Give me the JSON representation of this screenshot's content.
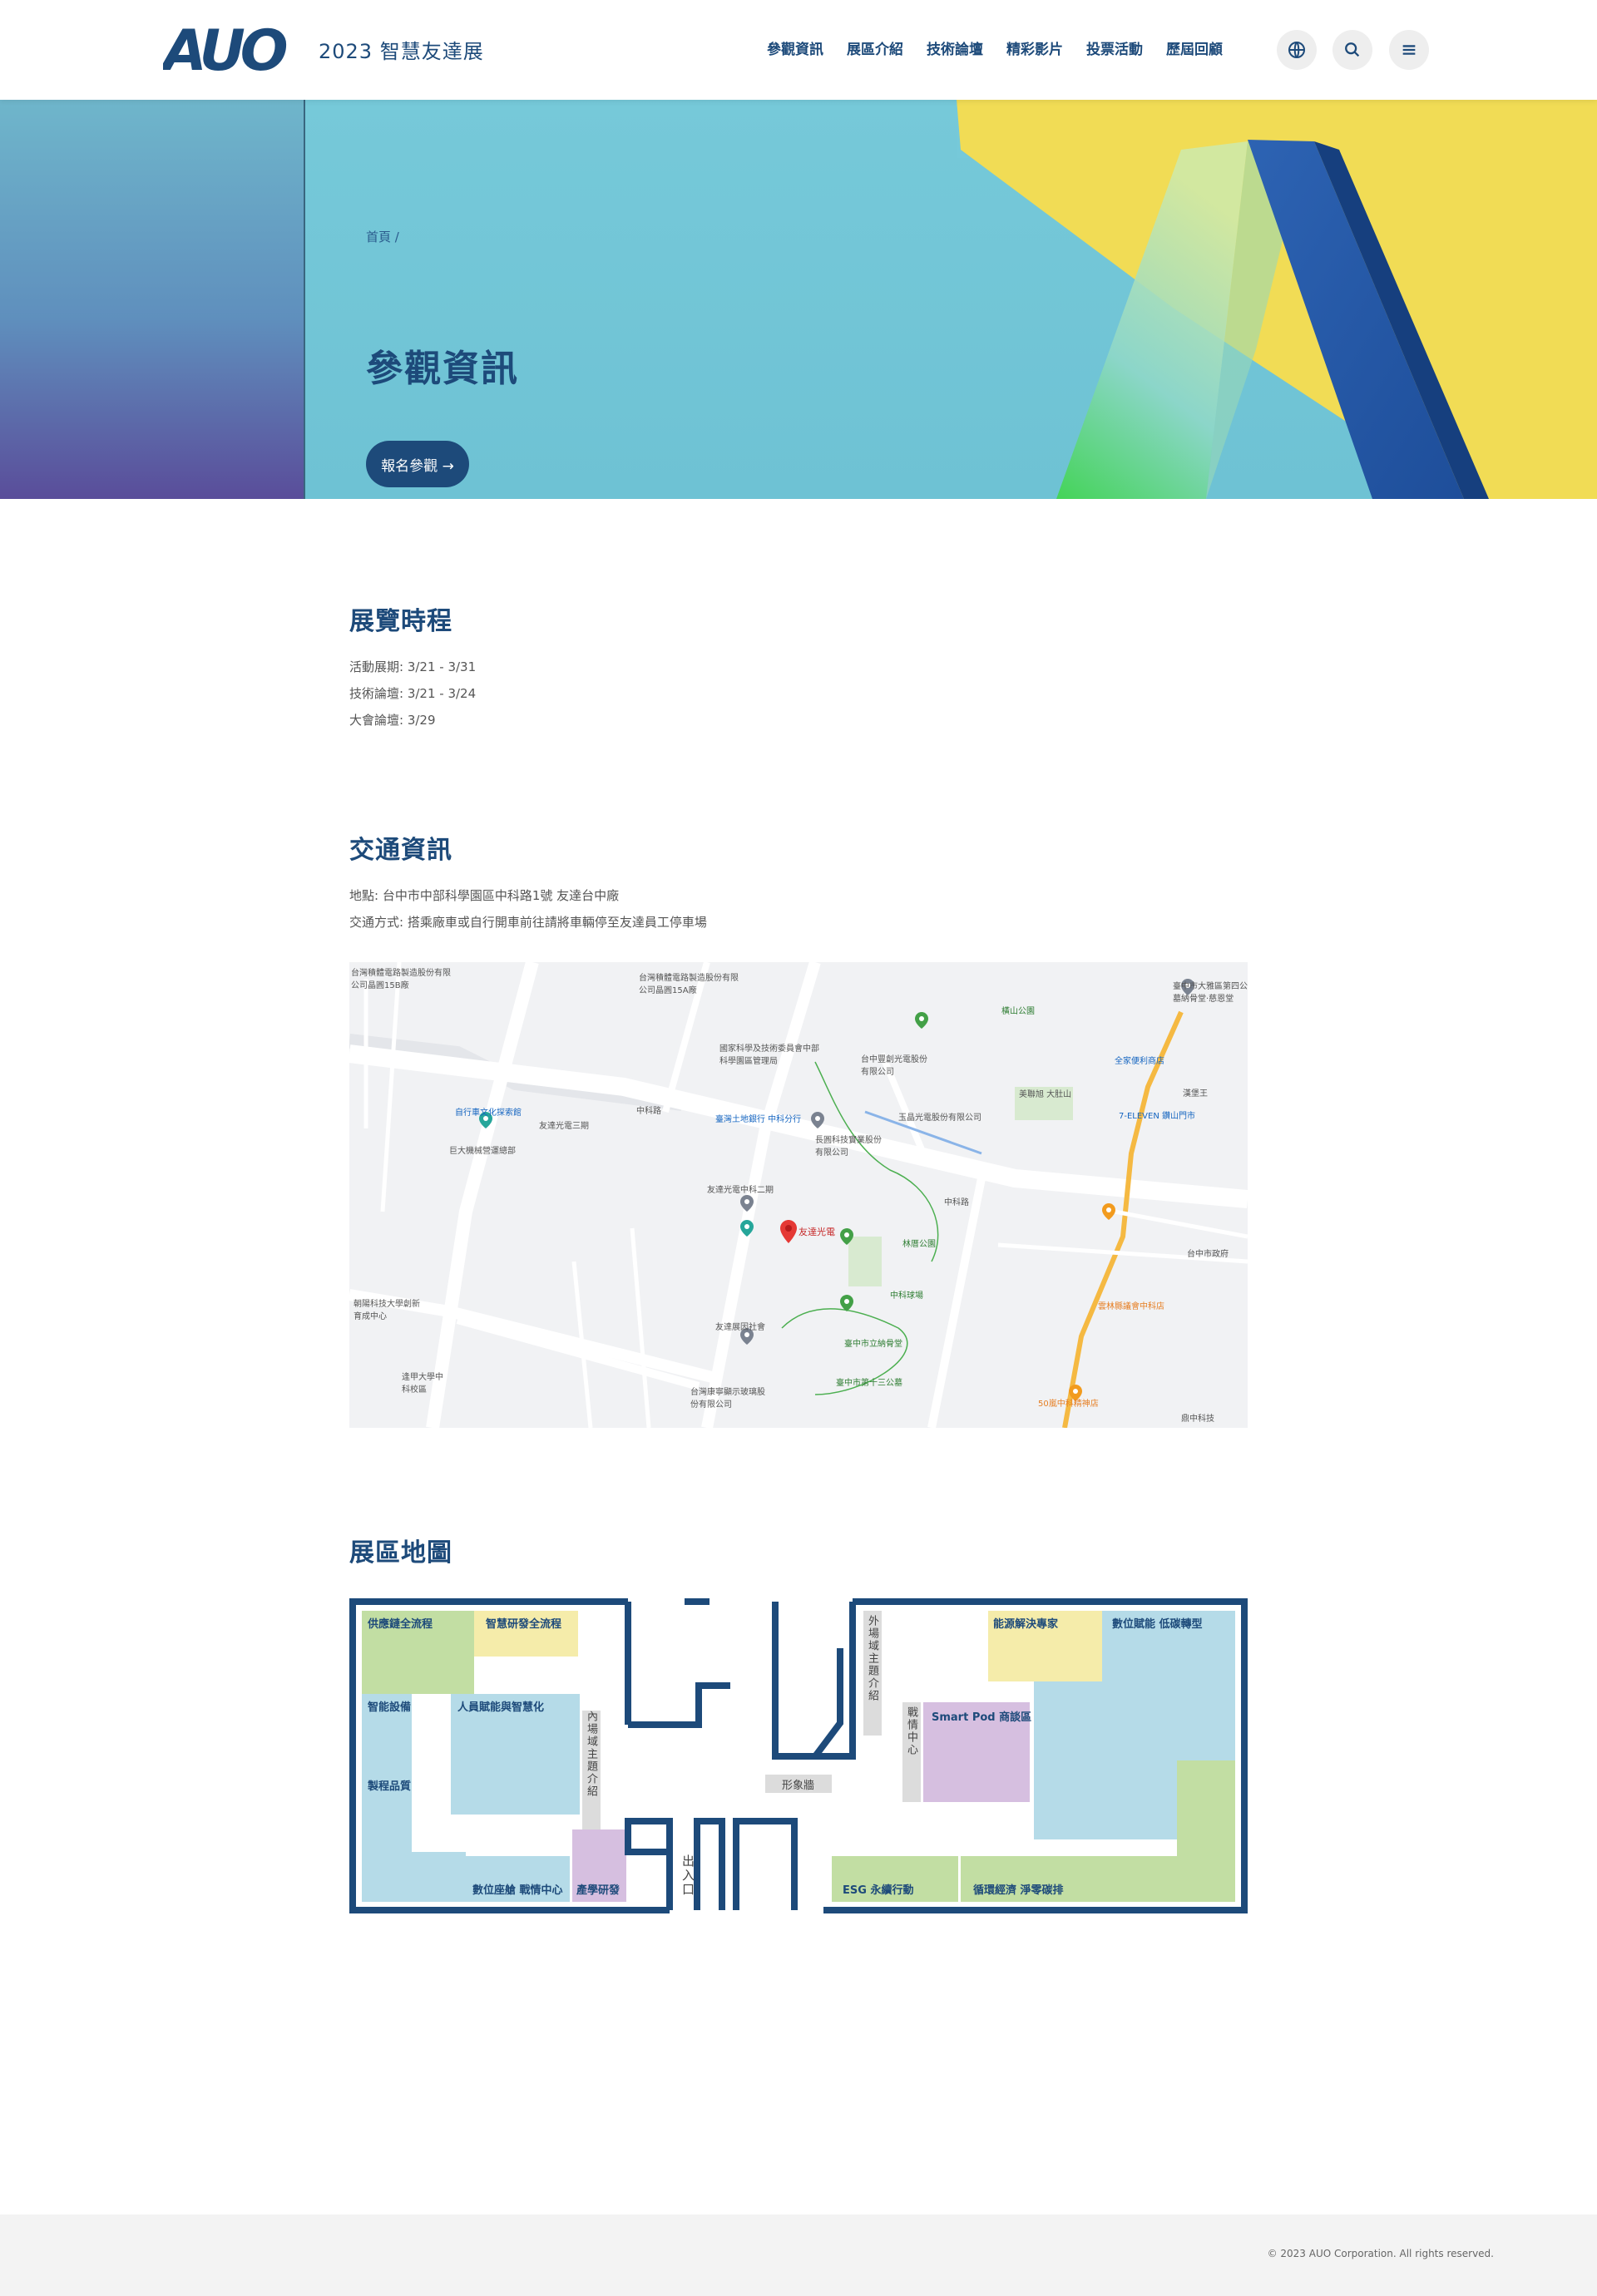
{
  "header": {
    "logo_text": "AUO",
    "site_title": "2023 智慧友達展",
    "nav": [
      "參觀資訊",
      "展區介紹",
      "技術論壇",
      "精彩影片",
      "投票活動",
      "歷屆回顧"
    ],
    "icons": [
      "globe-icon",
      "search-icon",
      "menu-icon"
    ]
  },
  "hero": {
    "breadcrumb": "首頁 /",
    "title": "參觀資訊",
    "button_label": "報名參觀 →"
  },
  "schedule": {
    "title": "展覽時程",
    "lines": [
      "活動展期: 3/21 - 3/31",
      "技術論壇: 3/21 - 3/24",
      "大會論壇: 3/29"
    ]
  },
  "transport": {
    "title": "交通資訊",
    "address": "地點: 台中市中部科學園區中科路1號 友達台中廠",
    "method": "交通方式: 搭乘廠車或自行開車前往請將車輛停至友達員工停車場"
  },
  "map": {
    "labels": {
      "l1": "台灣積體電路製造股份有限公司晶圓15B廠",
      "l2": "台灣積體電路製造股份有限公司晶圓15A廠",
      "l3": "國家科學及技術委員會中部科學園區管理局",
      "l4": "台中豐創光電股份有限公司",
      "l5": "橫山公園",
      "l6": "臺中市大雅區第四公墓納骨堂·慈恩堂",
      "l7": "全家便利商店",
      "l8": "美聯旭 大肚山",
      "l9": "臺灣土地銀行 中科分行",
      "l10": "長圓科技實業股份有限公司",
      "l11": "玉晶光電股份有限公司",
      "l12": "7-ELEVEN 鑽山門市",
      "l13": "自行車文化探索館",
      "l14": "友達光電三期",
      "l15": "巨大機械營運總部",
      "l16": "友達光電中科二期",
      "l17": "友達光電",
      "l18": "林厝公園",
      "l19": "中科球場",
      "l20": "友達展因社會",
      "l21": "臺中市立納骨堂",
      "l22": "臺中市第十三公墓",
      "l23": "台灣康寧顯示玻璃股份有限公司",
      "l24": "朝陽科技大學創新育成中心",
      "l25": "逢甲大學中科校區",
      "l26": "漢堡王",
      "l27": "台中市政府",
      "l28": "雲林縣議會中科店",
      "l29": "50嵐中科精神店",
      "l30": "鼎中科技",
      "l31": "中科路"
    }
  },
  "floor_map": {
    "title": "展區地圖",
    "zones": {
      "supply_chain": "供應鏈全流程",
      "smart_rd": "智慧研發全流程",
      "smart_logistics": "智能設備",
      "human_ai": "人員賦能與智慧化",
      "manufacturing_quality": "製程品質",
      "inner_intro": "內場域主題介紹",
      "digital_center": "數位座艙 戰情中心",
      "industry_academia": "產學研發",
      "entrance": "出入口",
      "image_wall": "形象牆",
      "outer_intro": "外場域主題介紹",
      "energy": "能源解決專家",
      "digital_carbon": "數位賦能 低碳轉型",
      "smart_pod": "Smart Pod 商談區",
      "ops_center": "戰情中心",
      "esg": "ESG 永續行動",
      "circular": "循環經濟 淨零碳排"
    }
  },
  "footer": {
    "copyright": "© 2023 AUO Corporation. All rights reserved."
  }
}
